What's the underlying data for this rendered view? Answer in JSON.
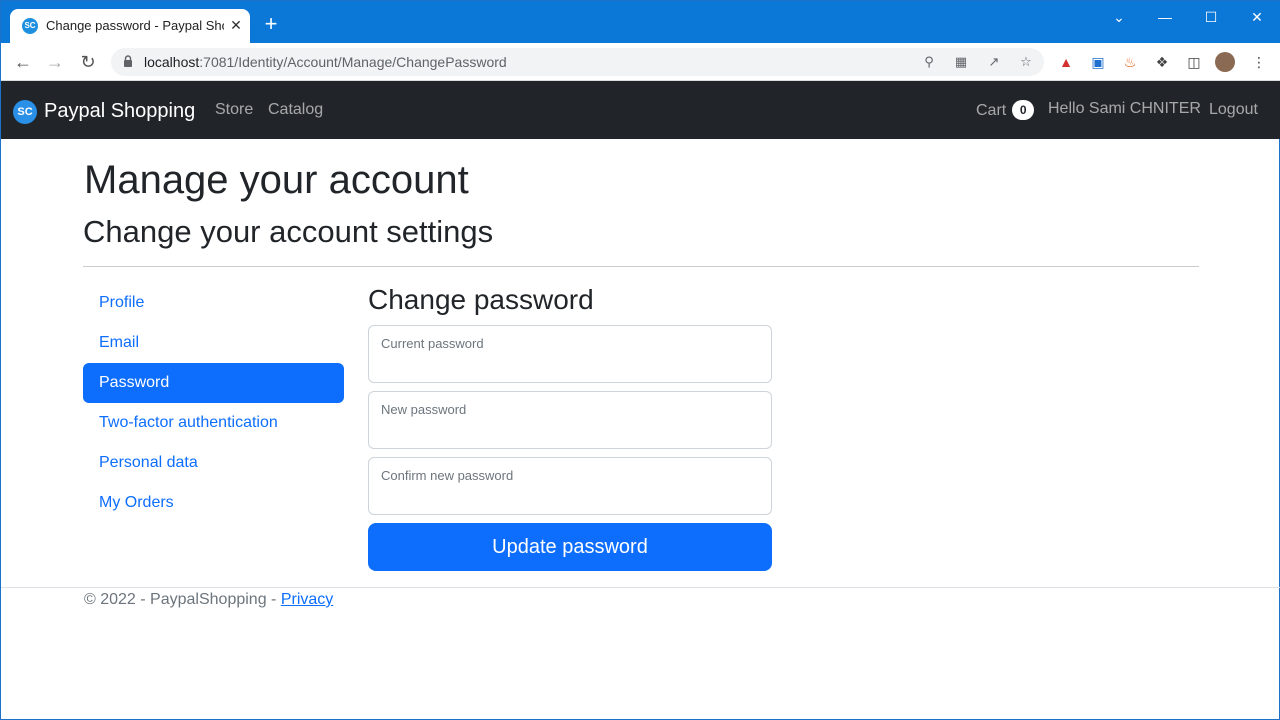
{
  "browser": {
    "tab_title": "Change password - Paypal Shopp",
    "tab_favicon": "SC",
    "tab_close": "✕",
    "new_tab": "+",
    "url_host": "localhost",
    "url_path": ":7081/Identity/Account/Manage/ChangePassword",
    "window_controls": {
      "minimize": "—",
      "maximize": "☐",
      "close": "✕",
      "menu": "⌄"
    }
  },
  "navbar": {
    "brand_logo": "SC",
    "brand": "Paypal Shopping",
    "links": {
      "store": "Store",
      "catalog": "Catalog"
    },
    "cart_label": "Cart",
    "cart_count": "0",
    "greeting": "Hello Sami CHNITER",
    "logout": "Logout"
  },
  "page": {
    "title": "Manage your account",
    "subtitle": "Change your account settings"
  },
  "sidebar": {
    "items": [
      {
        "label": "Profile",
        "active": false
      },
      {
        "label": "Email",
        "active": false
      },
      {
        "label": "Password",
        "active": true
      },
      {
        "label": "Two-factor authentication",
        "active": false
      },
      {
        "label": "Personal data",
        "active": false
      },
      {
        "label": "My Orders",
        "active": false
      }
    ]
  },
  "form": {
    "title": "Change password",
    "fields": {
      "current": {
        "label": "Current password",
        "value": ""
      },
      "new": {
        "label": "New password",
        "value": ""
      },
      "confirm": {
        "label": "Confirm new password",
        "value": ""
      }
    },
    "submit_label": "Update password"
  },
  "footer": {
    "text": "© 2022 - PaypalShopping - ",
    "privacy_link": "Privacy"
  },
  "colors": {
    "primary": "#0d6efd",
    "navbar_bg": "#212529",
    "browser_chrome": "#0b77d6"
  }
}
